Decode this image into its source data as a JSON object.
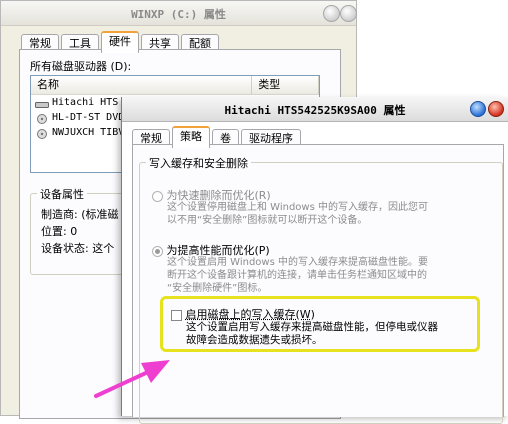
{
  "back_window": {
    "title": "WINXP (C:) 属性",
    "tabs": [
      "常规",
      "工具",
      "硬件",
      "共享",
      "配额"
    ],
    "active_tab": 2,
    "drives_label": "所有磁盘驱动器 (D):",
    "columns": [
      "名称",
      "类型"
    ],
    "drives": [
      "Hitachi HTS",
      "HL-DT-ST DVD",
      "NWJUXCH TIBV"
    ],
    "device_props_title": "设备属性",
    "manufacturer": "制造商: (标准磁",
    "location": "位置: 0",
    "status": "设备状态: 这个"
  },
  "front_window": {
    "title": "Hitachi HTS542525K9SA00 属性",
    "tabs": [
      "常规",
      "策略",
      "卷",
      "驱动程序"
    ],
    "active_tab": 1,
    "group_title": "写入缓存和安全删除",
    "option1": {
      "label": "为快速删除而优化(R)",
      "desc_line1": "这个设置停用磁盘上和 Windows 中的写入缓存，因此您可",
      "desc_line2": "以不用“安全删除”图标就可以断开这个设备。"
    },
    "option2": {
      "label": "为提高性能而优化(P)",
      "desc_line1": "这个设置启用 Windows 中的写入缓存来提高磁盘性能。要",
      "desc_line2": "断开这个设备跟计算机的连接，请单击任务栏通知区域中的",
      "desc_line3": "“安全删除硬件”图标。"
    },
    "option3": {
      "label": "启用磁盘上的写入缓存(W)",
      "desc_line1": "这个设置启用写入缓存来提高磁盘性能，但停电或仪器",
      "desc_line2": "故障会造成数据遗失或损坏。"
    }
  },
  "colors": {
    "highlight": "#e6e21e",
    "arrow": "#ee3fd0",
    "tab_accent": "#f2a23a"
  }
}
